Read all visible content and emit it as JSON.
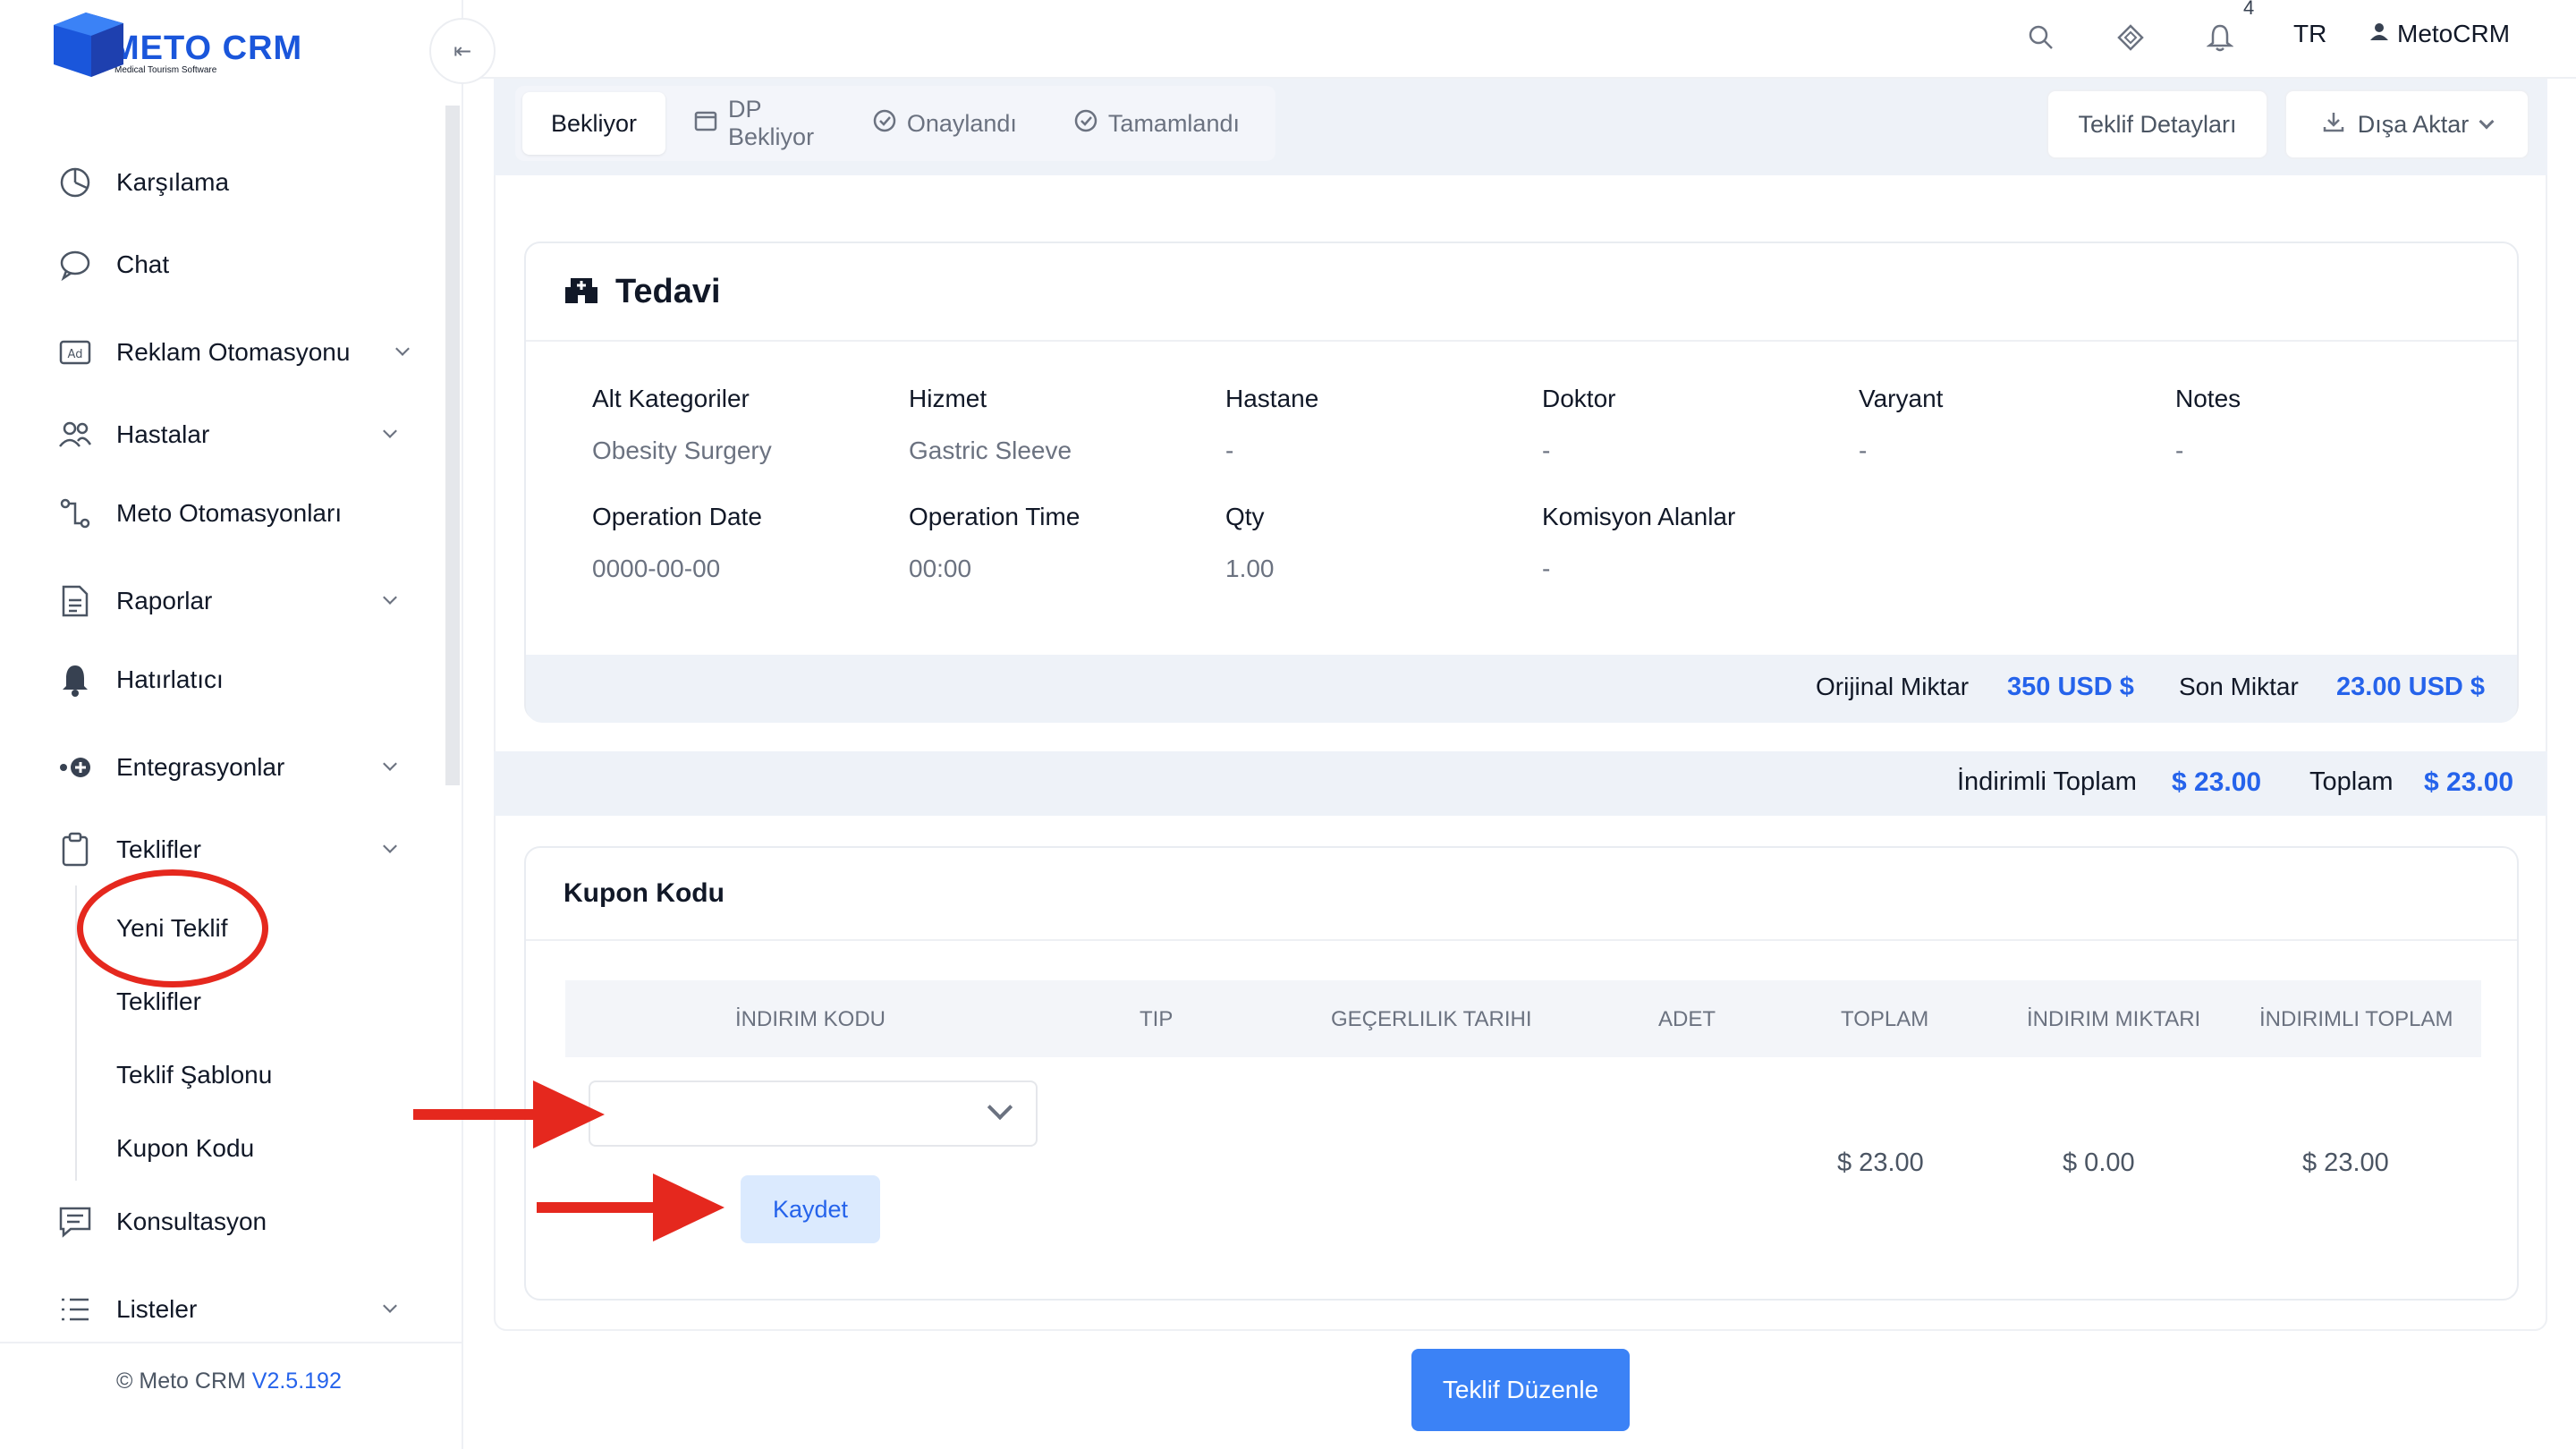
{
  "logo": {
    "title": "METO CRM",
    "subtitle": "Medical Tourism Software"
  },
  "sidebar": {
    "items": [
      {
        "label": "Karşılama",
        "icon": "dashboard-icon"
      },
      {
        "label": "Chat",
        "icon": "chat-bubble-icon"
      },
      {
        "label": "Reklam Otomasyonu",
        "icon": "ad-icon"
      },
      {
        "label": "Hastalar",
        "icon": "users-icon"
      },
      {
        "label": "Meto Otomasyonları",
        "icon": "automation-icon"
      },
      {
        "label": "Raporlar",
        "icon": "report-icon"
      },
      {
        "label": "Hatırlatıcı",
        "icon": "bell-icon"
      },
      {
        "label": "Entegrasyonlar",
        "icon": "integration-icon"
      },
      {
        "label": "Teklifler",
        "icon": "clipboard-icon"
      },
      {
        "label": "Konsultasyon",
        "icon": "message-icon"
      },
      {
        "label": "Listeler",
        "icon": "list-icon"
      }
    ],
    "sub_items": [
      "Yeni Teklif",
      "Teklifler",
      "Teklif Şablonu",
      "Kupon Kodu"
    ],
    "footer": {
      "copyright": "© Meto CRM ",
      "version": "V2.5.192"
    }
  },
  "topbar": {
    "notification_count": "4",
    "language": "TR",
    "user": "MetoCRM"
  },
  "status_tabs": [
    {
      "label": "Bekliyor",
      "active": true
    },
    {
      "label": "DP Bekliyor",
      "icon": "calendar-icon"
    },
    {
      "label": "Onaylandı",
      "icon": "check-circle-icon"
    },
    {
      "label": "Tamamlandı",
      "icon": "check-circle-icon"
    }
  ],
  "actions": {
    "details": "Teklif Detayları",
    "export": "Dışa Aktar"
  },
  "tedavi": {
    "title": "Tedavi",
    "row1": [
      {
        "label": "Alt Kategoriler",
        "value": "Obesity Surgery"
      },
      {
        "label": "Hizmet",
        "value": "Gastric Sleeve"
      },
      {
        "label": "Hastane",
        "value": "-"
      },
      {
        "label": "Doktor",
        "value": "-"
      },
      {
        "label": "Varyant",
        "value": "-"
      },
      {
        "label": "Notes",
        "value": "-"
      }
    ],
    "row2": [
      {
        "label": "Operation Date",
        "value": "0000-00-00"
      },
      {
        "label": "Operation Time",
        "value": "00:00"
      },
      {
        "label": "Qty",
        "value": "1.00"
      },
      {
        "label": "Komisyon Alanlar",
        "value": "-"
      }
    ],
    "original_label": "Orijinal Miktar",
    "original_value": "350 USD $",
    "final_label": "Son Miktar",
    "final_value": "23.00 USD $"
  },
  "totals": {
    "discounted_label": "İndirimli Toplam",
    "discounted_value": "$ 23.00",
    "total_label": "Toplam",
    "total_value": "$ 23.00"
  },
  "kupon": {
    "title": "Kupon Kodu",
    "columns": [
      "İNDIRIM KODU",
      "TIP",
      "GEÇERLILIK TARIHI",
      "ADET",
      "TOPLAM",
      "İNDIRIM MIKTARI",
      "İNDIRIMLI TOPLAM"
    ],
    "values": {
      "toplam": "$ 23.00",
      "indirim": "$ 0.00",
      "indirimli": "$ 23.00"
    },
    "save_label": "Kaydet"
  },
  "primary_action": "Teklif Düzenle",
  "colors": {
    "accent": "#2563eb",
    "annotation": "#e5281e"
  }
}
